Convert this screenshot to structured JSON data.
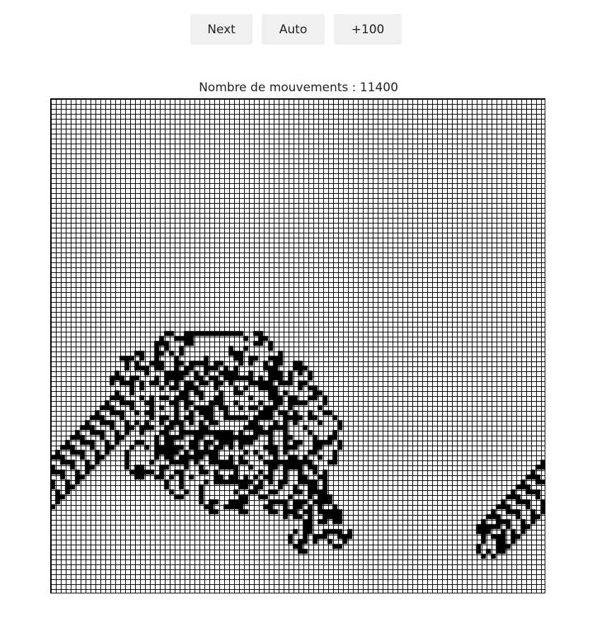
{
  "controls": {
    "next_label": "Next",
    "auto_label": "Auto",
    "plus100_label": "+100"
  },
  "status": {
    "counter_text": "Nombre de mouvements : 11400",
    "moves": 11400
  },
  "grid": {
    "columns": 100,
    "rows": 100,
    "colors": {
      "cell_on": "#000000",
      "cell_off": "#ffffff",
      "grid_line": "#000000"
    }
  }
}
